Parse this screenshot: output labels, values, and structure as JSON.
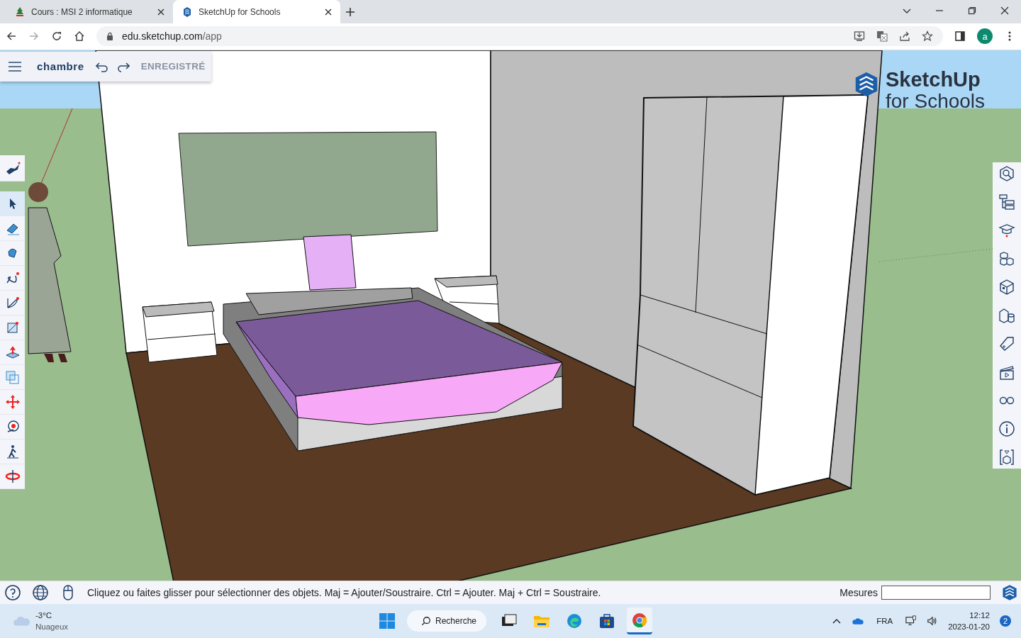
{
  "browser": {
    "tabs": [
      {
        "title": "Cours : MSI 2 informatique",
        "selected": false
      },
      {
        "title": "SketchUp for Schools",
        "selected": true
      }
    ],
    "address_host": "edu.sketchup.com",
    "address_path": "/app",
    "profile_initial": "a"
  },
  "app": {
    "model_name": "chambre",
    "save_status": "ENREGISTRÉ",
    "logo": {
      "line_1": "SketchUp",
      "line_2": "for Schools"
    },
    "tools": [
      {
        "kind": "character",
        "selected": false
      },
      {
        "kind": "select",
        "selected": true
      },
      {
        "kind": "eraser",
        "selected": false
      },
      {
        "kind": "paint",
        "selected": false
      },
      {
        "kind": "freehand",
        "selected": false
      },
      {
        "kind": "arc",
        "selected": false
      },
      {
        "kind": "rectangle",
        "selected": false
      },
      {
        "kind": "pushpull",
        "selected": false
      },
      {
        "kind": "offset",
        "selected": false
      },
      {
        "kind": "move",
        "selected": false
      },
      {
        "kind": "tape",
        "selected": false
      },
      {
        "kind": "walk",
        "selected": false
      },
      {
        "kind": "orbit",
        "selected": false
      }
    ],
    "status_message": "Cliquez ou faites glisser pour sélectionner des objets. Maj = Ajouter/Soustraire. Ctrl = Ajouter. Maj + Ctrl = Soustraire.",
    "measurements_label": "Mesures"
  },
  "taskbar": {
    "weather": {
      "temperature": "-3°C",
      "condition": "Nuageux"
    },
    "search": "Recherche",
    "apps": [
      {
        "kind": "taskview",
        "active": false
      },
      {
        "kind": "explorer",
        "active": false
      },
      {
        "kind": "edge",
        "active": false
      },
      {
        "kind": "store",
        "active": false
      },
      {
        "kind": "chrome",
        "active": true
      }
    ],
    "language": "FRA",
    "time": "12:12",
    "date": "2023-01-20",
    "notifications": "2"
  }
}
